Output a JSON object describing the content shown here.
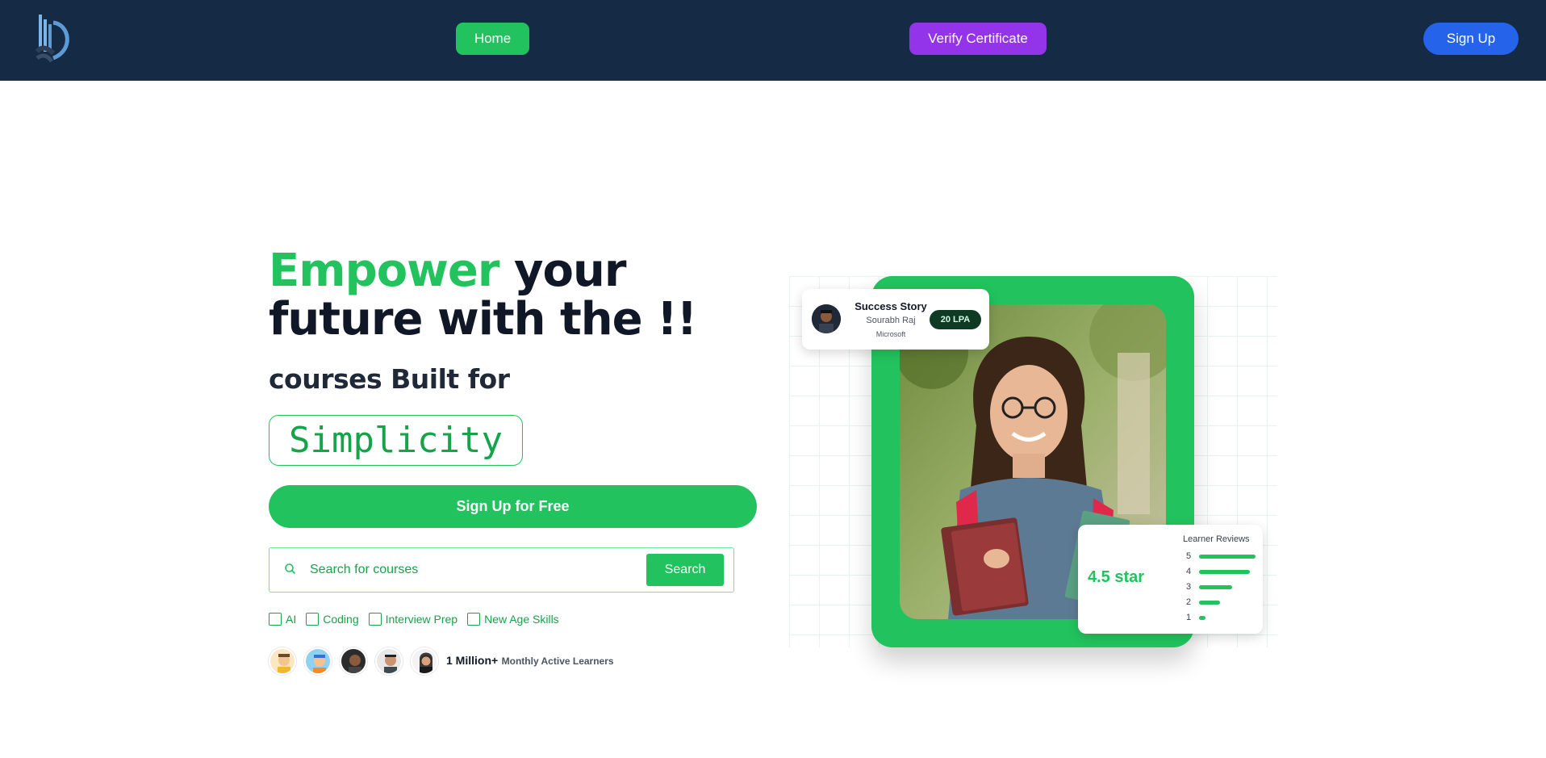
{
  "nav": {
    "home_label": "Home",
    "verify_label": "Verify Certificate",
    "signup_label": "Sign Up"
  },
  "hero": {
    "headline_accent": "Empower",
    "headline_rest": " your future with the !!",
    "subline": "courses Built for",
    "typed_word": "Simplicity",
    "cta_label": "Sign Up for Free"
  },
  "search": {
    "placeholder": "Search for courses",
    "value": "",
    "button_label": "Search"
  },
  "filters": [
    "AI",
    "Coding",
    "Interview Prep",
    "New Age Skills"
  ],
  "learners": {
    "count": "1 Million+",
    "label": "Monthly Active Learners"
  },
  "story_card": {
    "title": "Success Story",
    "name": "Sourabh Raj",
    "company": "Microsoft",
    "badge": "20 LPA"
  },
  "reviews": {
    "rating_text": "4.5 star",
    "title": "Learner Reviews",
    "levels": [
      "5",
      "4",
      "3",
      "2",
      "1"
    ],
    "fractions": [
      1.0,
      0.9,
      0.58,
      0.37,
      0.12
    ]
  },
  "colors": {
    "nav_bg": "#152a45",
    "accent_green": "#22c35e",
    "verify_purple": "#9333ea",
    "signup_blue": "#2563eb"
  }
}
